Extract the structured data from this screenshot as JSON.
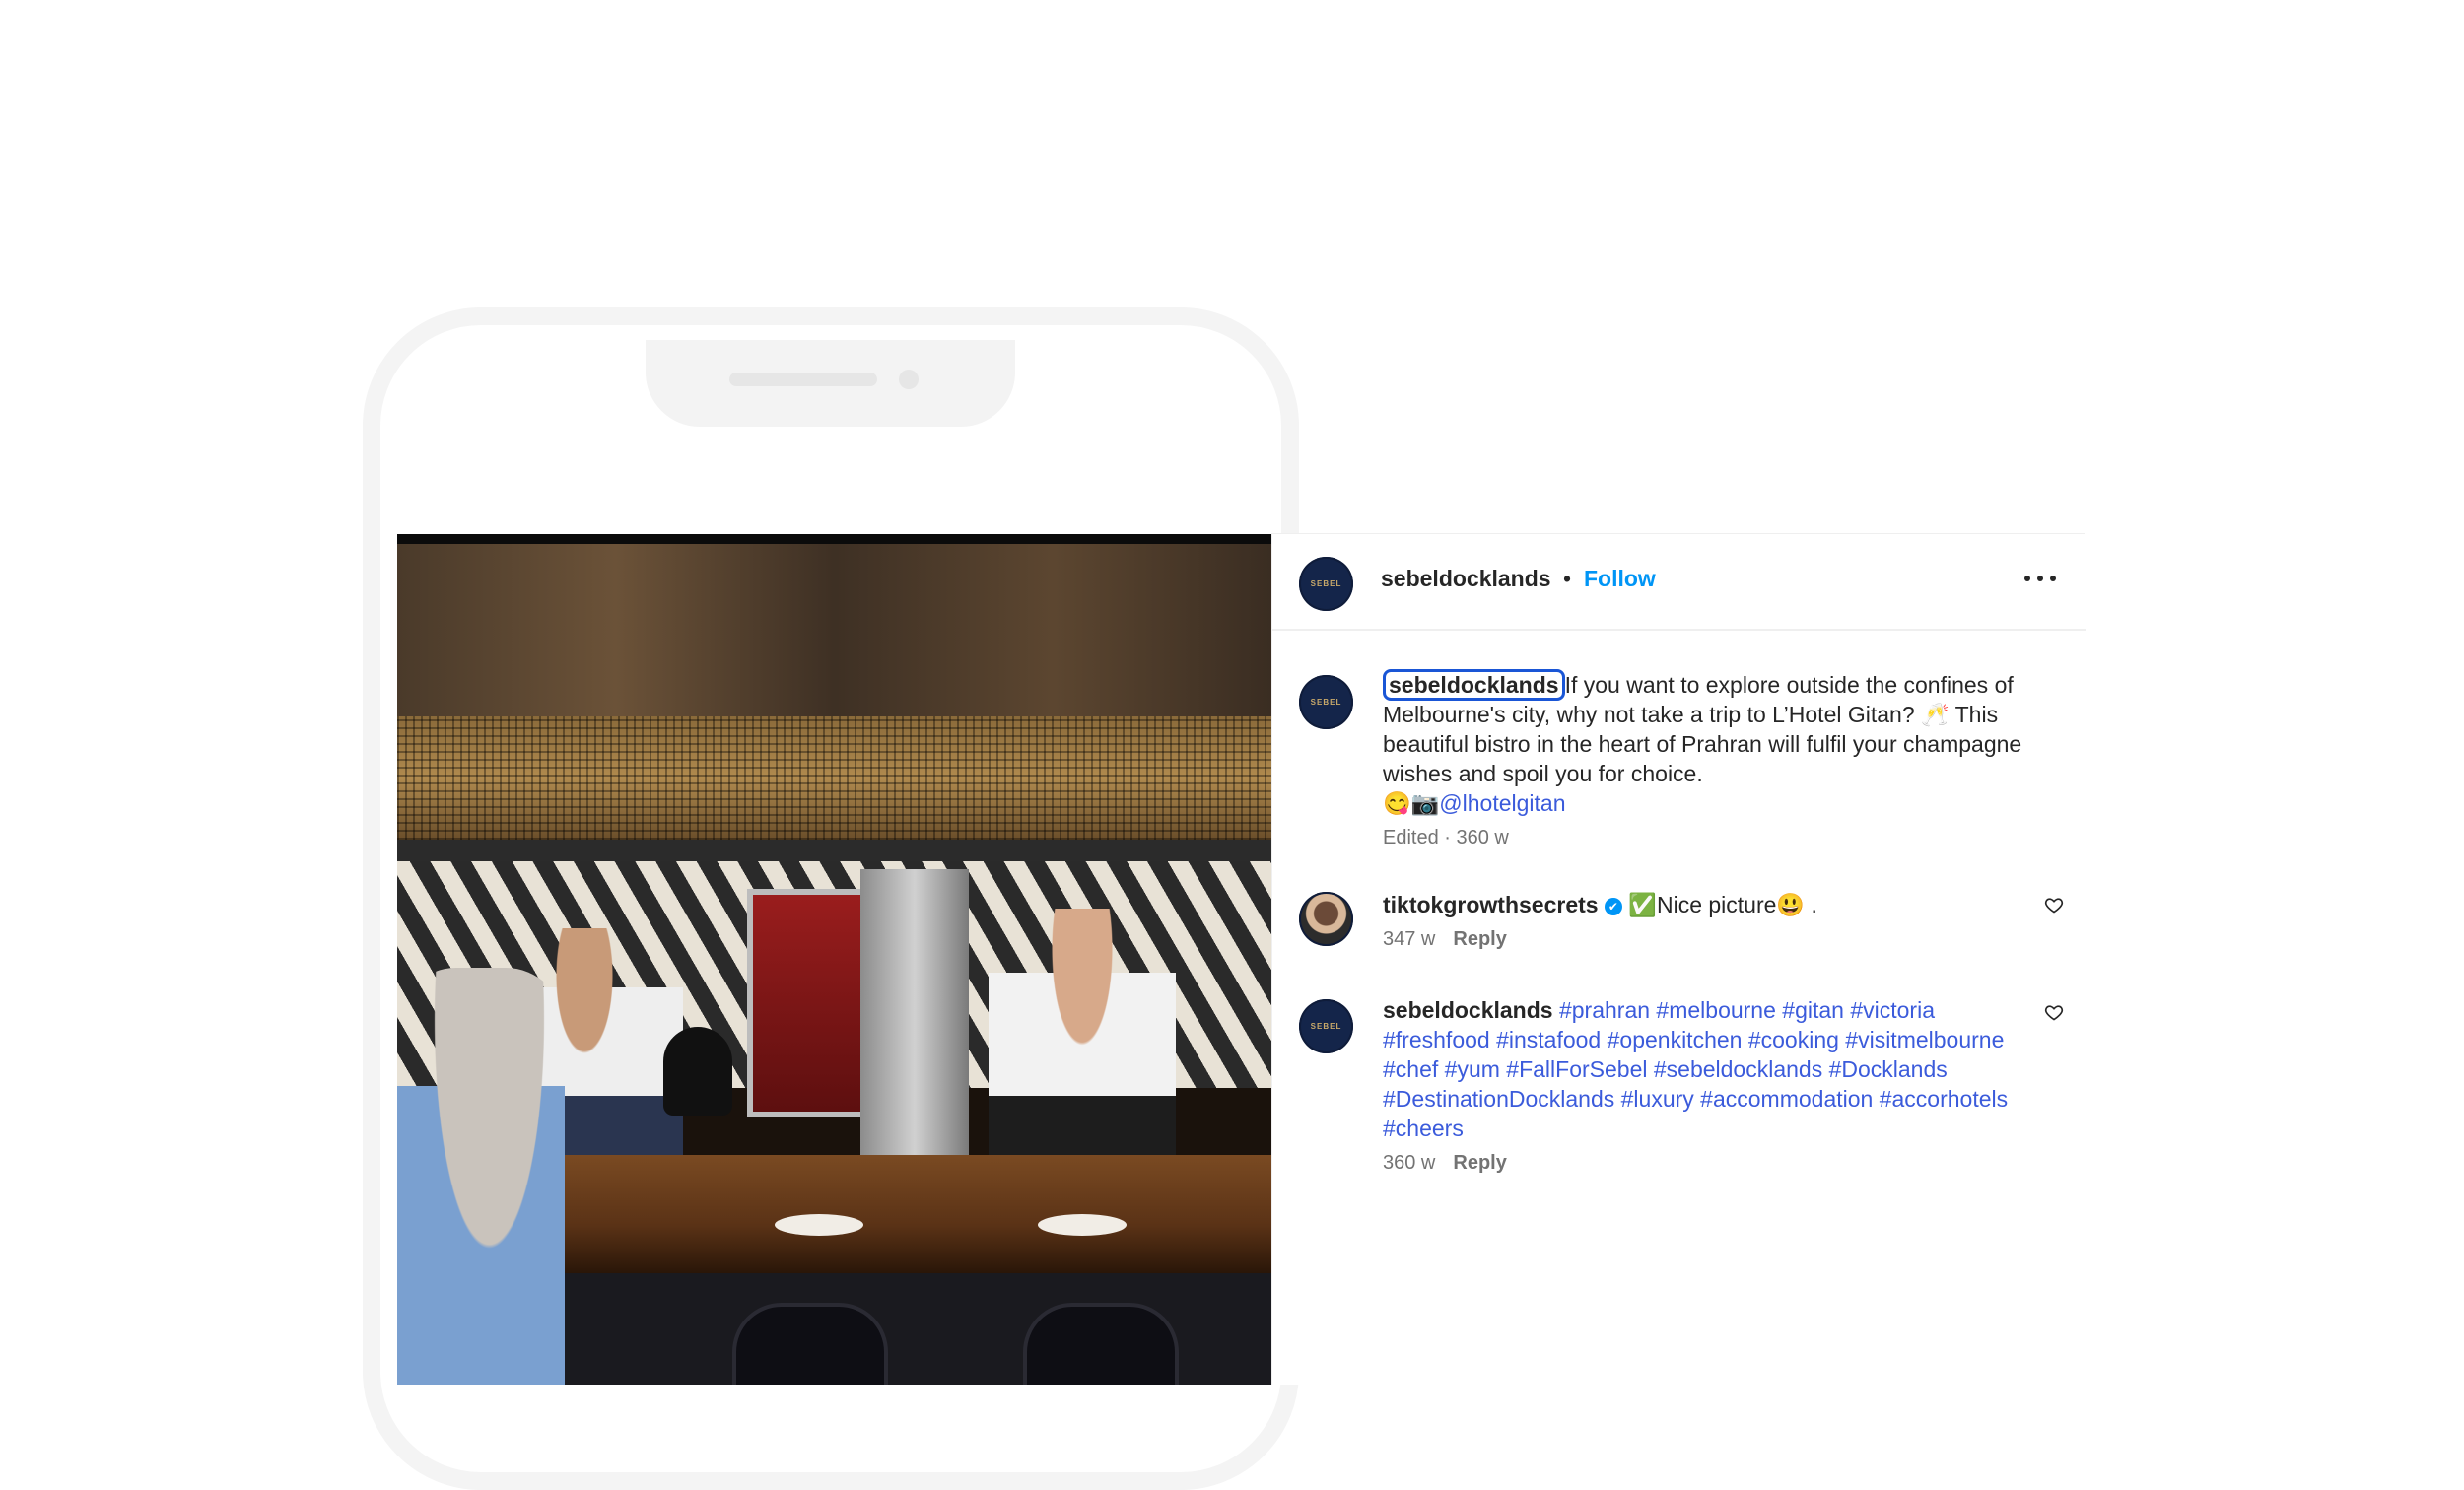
{
  "post": {
    "username": "sebeldocklands",
    "separator": "•",
    "follow_label": "Follow",
    "avatar_text": "SEBEL"
  },
  "caption": {
    "username": "sebeldocklands",
    "text": "If you want to explore outside the confines of Melbourne's city, why not take a trip to L’Hotel Gitan? 🥂  This beautiful bistro in the heart of Prahran will fulfil your champagne wishes and spoil you for choice.",
    "emoji_prefix": "😋📷",
    "mention": "@lhotelgitan",
    "meta": "Edited · 360 w"
  },
  "comments": [
    {
      "username": "tiktokgrowthsecrets",
      "verified_symbol": "✔",
      "text": "✅Nice picture😃 .",
      "time": "347 w",
      "reply_label": "Reply",
      "icon": "heart-icon"
    },
    {
      "username": "sebeldocklands",
      "hashtags": "#prahran #melbourne  #gitan #victoria #freshfood #instafood #openkitchen #cooking #visitmelbourne #chef #yum #FallForSebel #sebeldocklands #Docklands #DestinationDocklands #luxury #accommodation #accorhotels #cheers",
      "time": "360 w",
      "reply_label": "Reply",
      "avatar_text": "SEBEL",
      "icon": "heart-icon"
    }
  ],
  "colors": {
    "follow": "#0095f6",
    "link": "#3b5bdb",
    "highlight_border": "#1a56d6",
    "avatar_bg": "#14254a"
  }
}
